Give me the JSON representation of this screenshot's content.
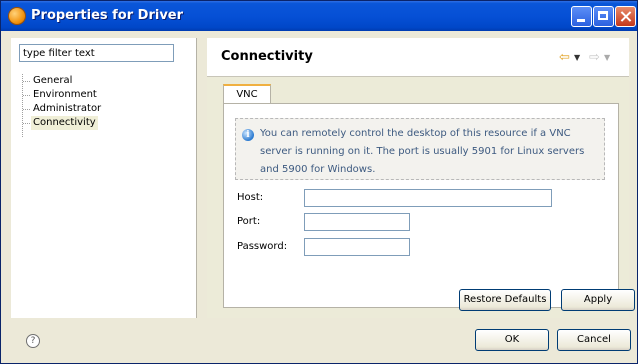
{
  "window": {
    "title": "Properties for Driver"
  },
  "filter": {
    "value": "type filter text"
  },
  "tree": {
    "items": [
      "General",
      "Environment",
      "Administrator",
      "Connectivity"
    ],
    "selected": "Connectivity"
  },
  "page": {
    "title": "Connectivity"
  },
  "tabs": [
    {
      "label": "VNC",
      "active": true
    }
  ],
  "info": {
    "text": "You can remotely control the desktop of this resource if a VNC server is running on it. The port is usually 5901 for Linux servers and 5900 for Windows."
  },
  "form": {
    "host_label": "Host:",
    "host_value": "",
    "port_label": "Port:",
    "port_value": "",
    "password_label": "Password:",
    "password_value": ""
  },
  "buttons": {
    "restore_defaults": "Restore Defaults",
    "apply": "Apply",
    "ok": "OK",
    "cancel": "Cancel"
  },
  "icons": {
    "title": "app-icon",
    "help": "help-icon",
    "back": "back-arrow-icon",
    "forward": "forward-arrow-icon",
    "info": "info-icon",
    "minimize": "minimize-icon",
    "maximize": "maximize-icon",
    "close": "close-icon"
  },
  "colors": {
    "title_bar": "#0650d6",
    "info_text": "#3d5a80",
    "tab_highlight": "#f0b040"
  }
}
